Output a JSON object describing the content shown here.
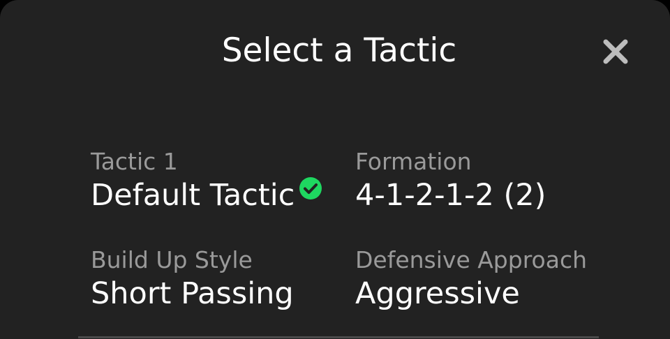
{
  "dialog": {
    "title": "Select a Tactic",
    "close_icon": "close-icon",
    "check_color": "#1ed760"
  },
  "tactic": {
    "name_label": "Tactic 1",
    "name_value": "Default Tactic",
    "formation_label": "Formation",
    "formation_value": "4-1-2-1-2 (2)",
    "build_up_label": "Build Up Style",
    "build_up_value": "Short Passing",
    "defensive_label": "Defensive Approach",
    "defensive_value": "Aggressive"
  }
}
